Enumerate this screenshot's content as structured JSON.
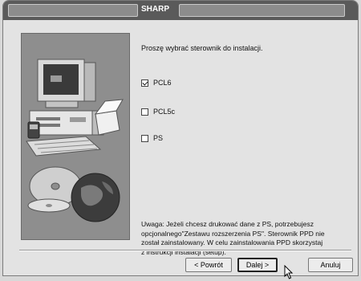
{
  "window": {
    "title": "SHARP"
  },
  "content": {
    "prompt": "Proszę wybrać sterownik do instalacji.",
    "options": [
      {
        "label": "PCL6",
        "checked": true
      },
      {
        "label": "PCL5c",
        "checked": false
      },
      {
        "label": "PS",
        "checked": false
      }
    ],
    "note_lines": [
      "Uwaga: Jeżeli chcesz drukować dane z PS, potrzebujesz",
      "opcjonalnego\"Zestawu rozszerzenia PS\". Sterownik PPD nie",
      "został zainstalowany. W celu zainstalowania PPD skorzystaj",
      "z instrukcji instalacji (setup)."
    ]
  },
  "buttons": {
    "back": "< Powrót",
    "next": "Dalej >",
    "cancel": "Anuluj"
  },
  "icons": {
    "cursor": "mouse-pointer-icon",
    "art": "computer-cd-globe-illustration"
  }
}
